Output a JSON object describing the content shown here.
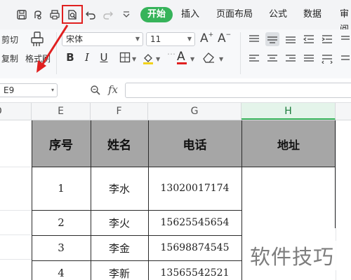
{
  "ribbon": {
    "tabs": [
      "开始",
      "插入",
      "页面布局",
      "公式",
      "数据",
      "审阅"
    ],
    "active_tab": "开始",
    "clipboard": {
      "cut_label": "剪切",
      "copy_label": "复制",
      "format_painter_label": "格式刷"
    },
    "font": {
      "name": "宋体",
      "size": "11"
    },
    "format_buttons": {
      "bold": "B",
      "italic": "I",
      "underline": "U",
      "font_color": "A"
    }
  },
  "formula_bar": {
    "cell_ref": "E9",
    "fx_label": "fx",
    "value": ""
  },
  "columns": [
    "D",
    "E",
    "F",
    "G",
    "H"
  ],
  "selected_column": "H",
  "table": {
    "headers": [
      "序号",
      "姓名",
      "电话",
      "地址"
    ],
    "rows": [
      [
        "1",
        "李水",
        "13020017174",
        ""
      ],
      [
        "2",
        "李火",
        "15625545654",
        ""
      ],
      [
        "3",
        "李金",
        "15698874545",
        ""
      ],
      [
        "4",
        "李新",
        "13565542521",
        ""
      ]
    ]
  },
  "watermark": "软件技巧",
  "colors": {
    "accent": "#36b35a",
    "header_fill": "#a6a6a6",
    "highlight": "#e02020"
  }
}
